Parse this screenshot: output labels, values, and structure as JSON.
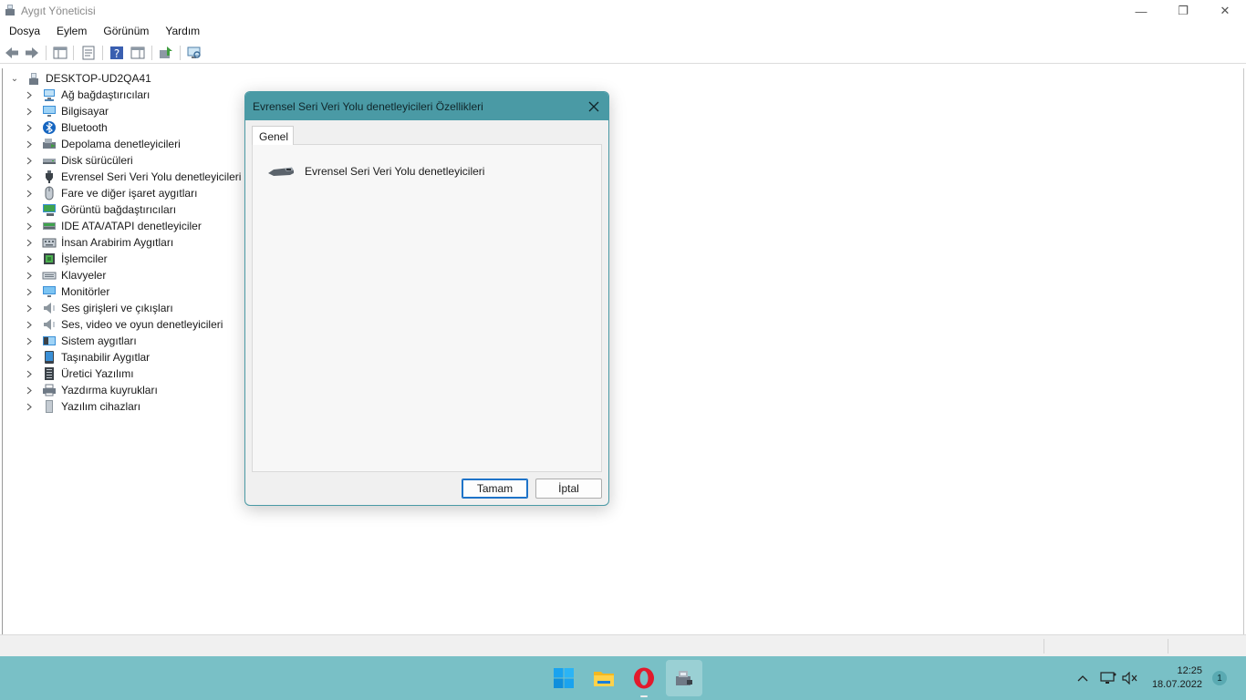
{
  "window": {
    "title": "Aygıt Yöneticisi",
    "controls": {
      "minimize": "—",
      "restore": "❐",
      "close": "✕"
    }
  },
  "menu": [
    "Dosya",
    "Eylem",
    "Görünüm",
    "Yardım"
  ],
  "toolbar": {
    "buttons": [
      "back-arrow-icon",
      "forward-arrow-icon",
      "console-tree-icon",
      "properties-icon",
      "help-icon",
      "action-pane-icon",
      "update-driver-icon",
      "scan-hardware-icon"
    ]
  },
  "tree": {
    "root": "DESKTOP-UD2QA41",
    "items": [
      {
        "label": "Ağ bağdaştırıcıları",
        "icon": "network-adapter-icon"
      },
      {
        "label": "Bilgisayar",
        "icon": "computer-icon"
      },
      {
        "label": "Bluetooth",
        "icon": "bluetooth-icon"
      },
      {
        "label": "Depolama denetleyicileri",
        "icon": "storage-controller-icon"
      },
      {
        "label": "Disk sürücüleri",
        "icon": "disk-drive-icon"
      },
      {
        "label": "Evrensel Seri Veri Yolu denetleyicileri",
        "icon": "usb-controller-icon"
      },
      {
        "label": "Fare ve diğer işaret aygıtları",
        "icon": "mouse-icon"
      },
      {
        "label": "Görüntü bağdaştırıcıları",
        "icon": "display-adapter-icon"
      },
      {
        "label": "IDE ATA/ATAPI denetleyiciler",
        "icon": "ide-controller-icon"
      },
      {
        "label": "İnsan Arabirim Aygıtları",
        "icon": "hid-icon"
      },
      {
        "label": "İşlemciler",
        "icon": "processor-icon"
      },
      {
        "label": "Klavyeler",
        "icon": "keyboard-icon"
      },
      {
        "label": "Monitörler",
        "icon": "monitor-icon"
      },
      {
        "label": "Ses girişleri ve çıkışları",
        "icon": "audio-io-icon"
      },
      {
        "label": "Ses, video ve oyun denetleyicileri",
        "icon": "sound-controller-icon"
      },
      {
        "label": "Sistem aygıtları",
        "icon": "system-devices-icon"
      },
      {
        "label": "Taşınabilir Aygıtlar",
        "icon": "portable-device-icon"
      },
      {
        "label": "Üretici Yazılımı",
        "icon": "firmware-icon"
      },
      {
        "label": "Yazdırma kuyrukları",
        "icon": "print-queue-icon"
      },
      {
        "label": "Yazılım cihazları",
        "icon": "software-device-icon"
      }
    ]
  },
  "dialog": {
    "title": "Evrensel Seri Veri Yolu denetleyicileri Özellikleri",
    "tab": "Genel",
    "device_name": "Evrensel Seri Veri Yolu denetleyicileri",
    "ok": "Tamam",
    "cancel": "İptal"
  },
  "taskbar": {
    "apps": [
      "windows-start-icon",
      "file-explorer-icon",
      "opera-icon",
      "device-manager-icon"
    ],
    "clock_time": "12:25",
    "clock_date": "18.07.2022",
    "notification_count": "1",
    "accent": "#79c0c6"
  },
  "colors": {
    "dialog_title": "#4a9aa5",
    "taskbar": "#79c0c6"
  }
}
